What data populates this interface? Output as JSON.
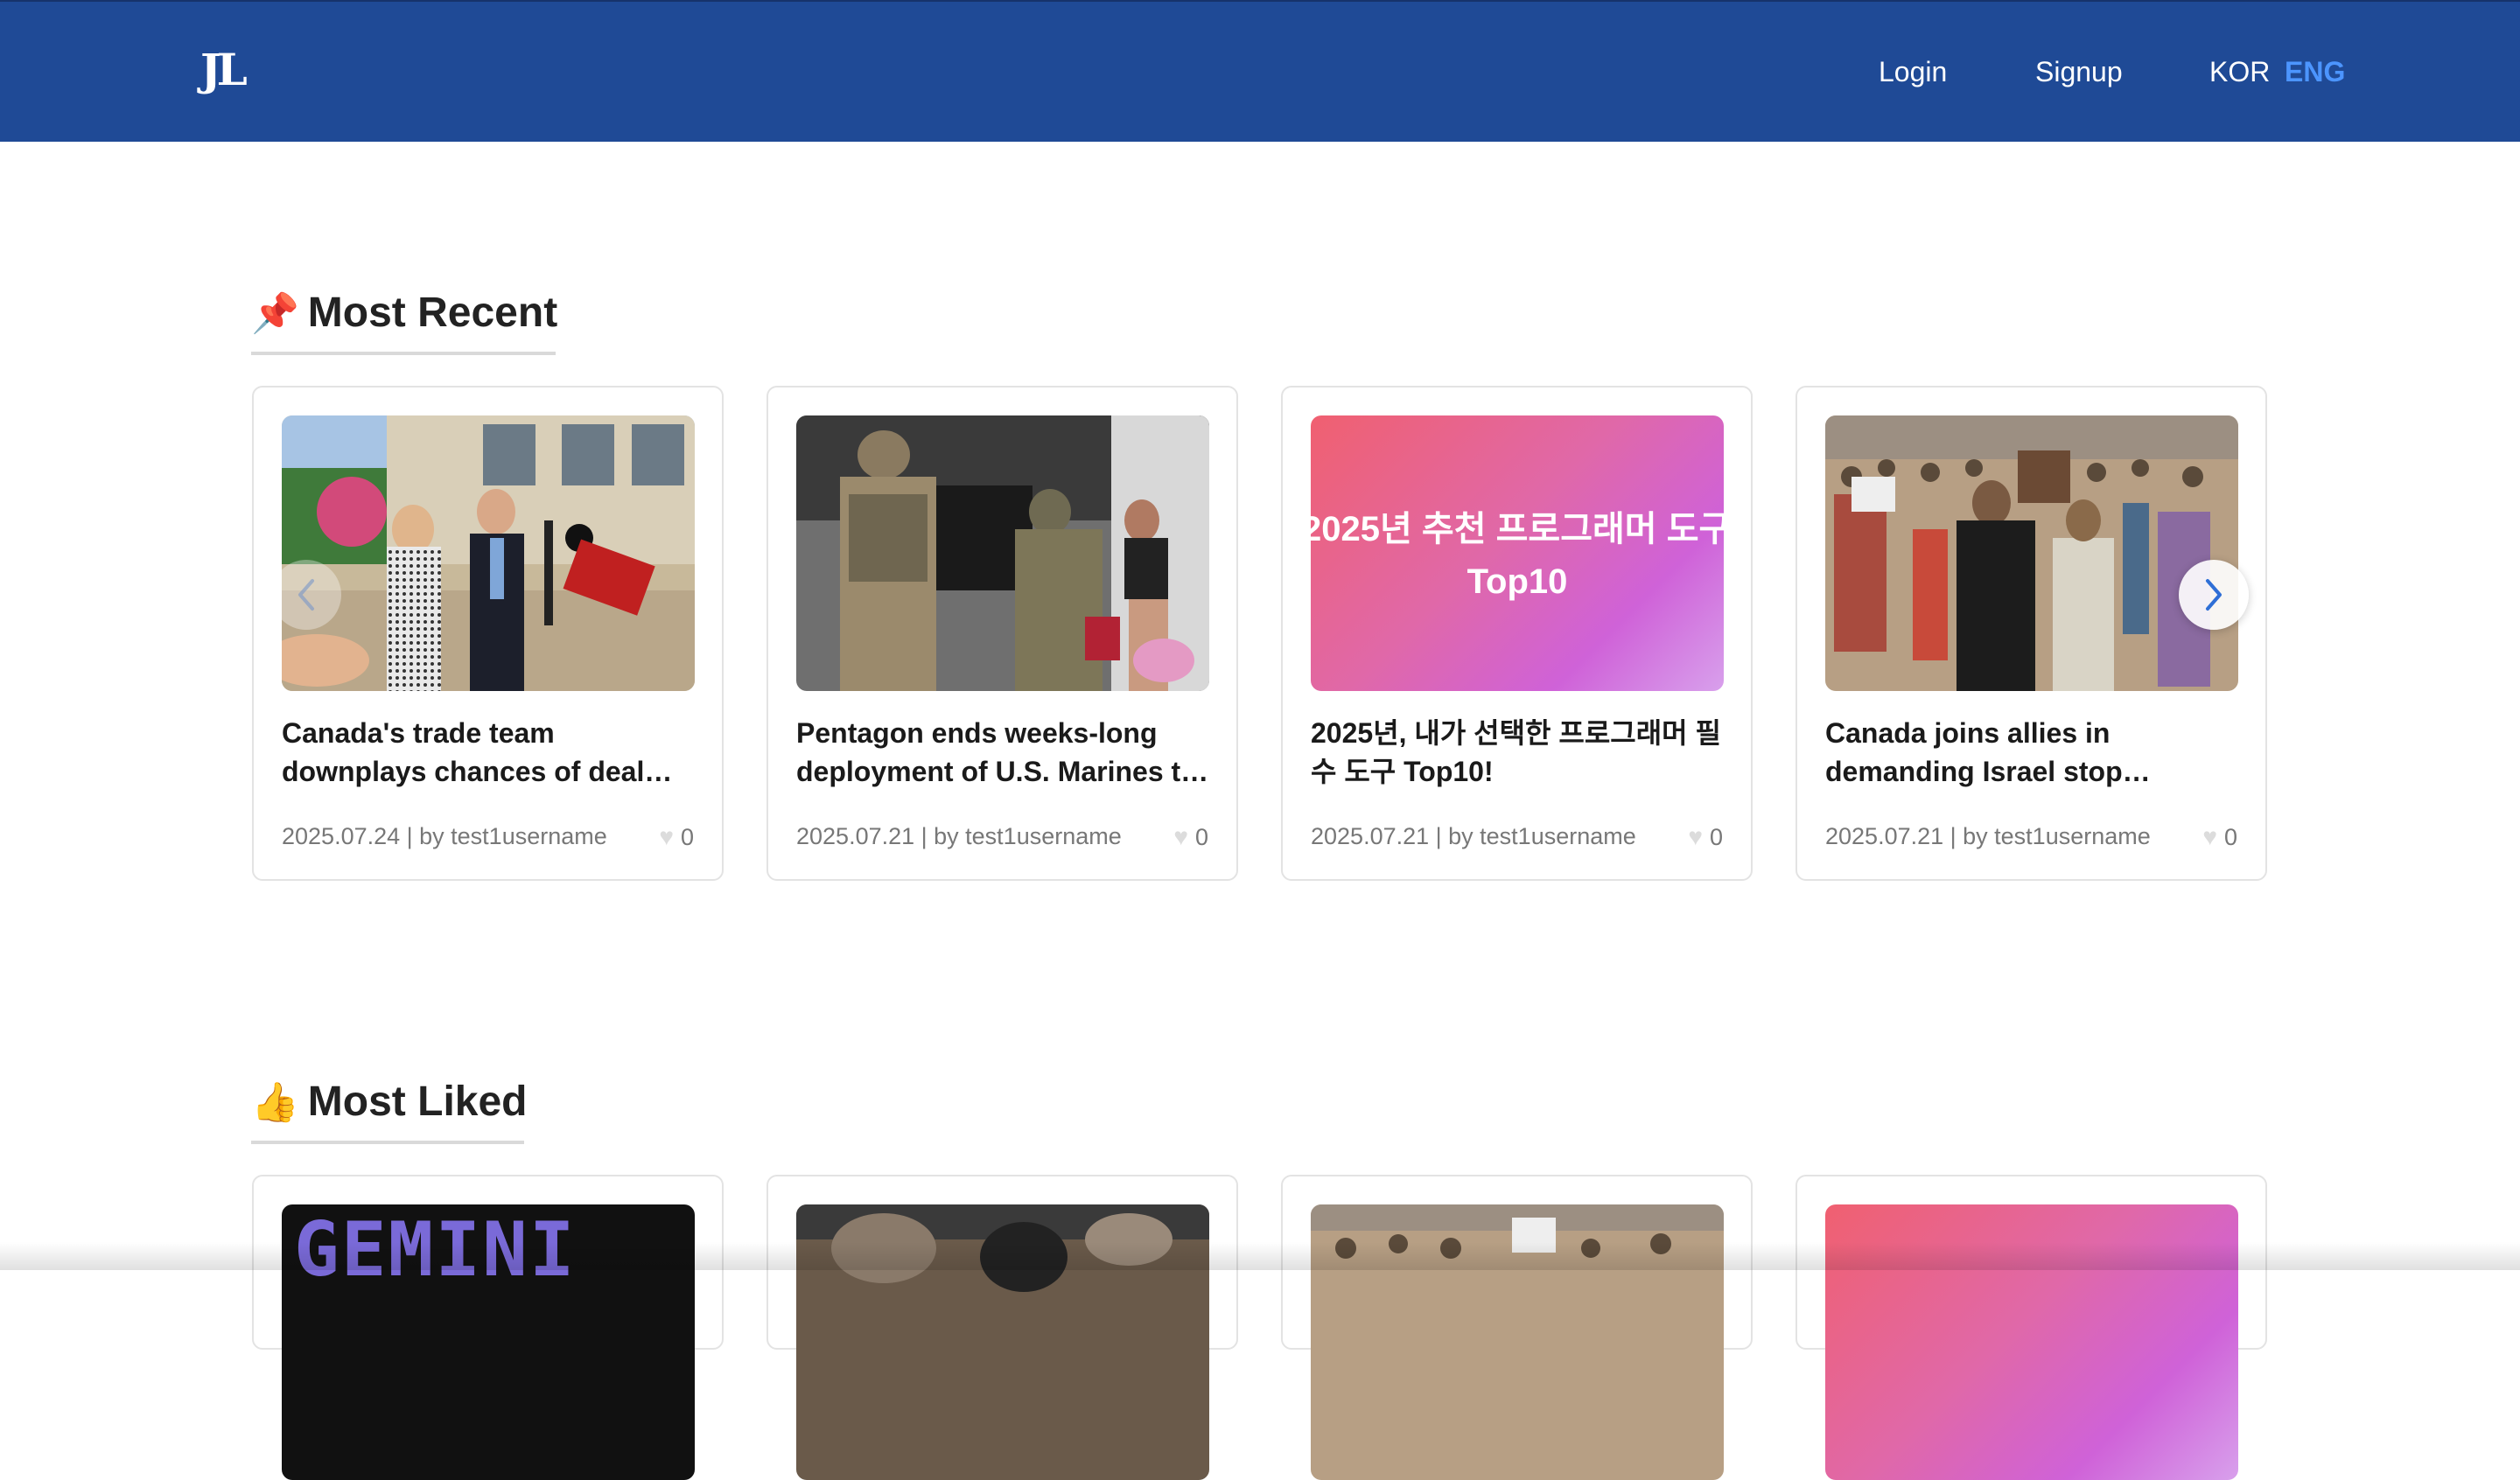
{
  "header": {
    "logo": "JL",
    "login_label": "Login",
    "signup_label": "Signup",
    "lang_kor": "KOR",
    "lang_eng": "ENG",
    "brand_color": "#1f4a96",
    "active_lang_color": "#4c95ff"
  },
  "most_recent": {
    "emoji": "📌",
    "title": "Most Recent",
    "cards": [
      {
        "title": "Canada's trade team downplays chances of deal…",
        "meta": "2025.07.24 | by test1username",
        "likes": "0"
      },
      {
        "title": "Pentagon ends weeks-long deployment of U.S. Marines t…",
        "meta": "2025.07.21 | by test1username",
        "likes": "0"
      },
      {
        "title": "2025년, 내가 선택한 프로그래머 필수 도구 Top10!",
        "meta": "2025.07.21 | by test1username",
        "likes": "0",
        "image_line1": "2025년 추천 프로그래머 도구",
        "image_line2": "Top10"
      },
      {
        "title": "Canada joins allies in demanding Israel stop…",
        "meta": "2025.07.21 | by test1username",
        "likes": "0"
      }
    ],
    "prev_icon": "chevron-left-icon",
    "next_icon": "chevron-right-icon"
  },
  "most_liked": {
    "emoji": "👍",
    "title": "Most Liked",
    "cards": [
      {
        "image_text": "GEMINI"
      }
    ]
  }
}
